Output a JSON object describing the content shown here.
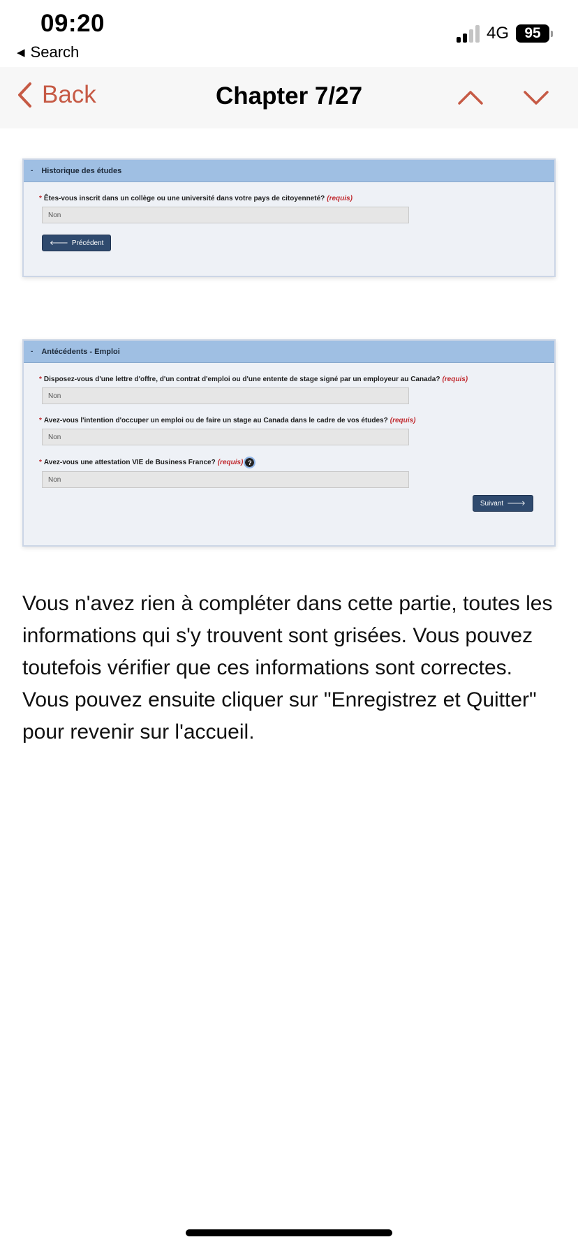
{
  "status_bar": {
    "time": "09:20",
    "back_app": "Search",
    "network": "4G",
    "battery": "95"
  },
  "nav": {
    "back_label": "Back",
    "title": "Chapter 7/27",
    "accent_color": "#c65a45"
  },
  "card1": {
    "header": "Historique des études",
    "collapse_symbol": "-",
    "question": "Êtes-vous inscrit dans un collège ou une université dans votre pays de citoyenneté?",
    "required_label": "(requis)",
    "answer": "Non",
    "prev_button": "Précédent"
  },
  "card2": {
    "header": "Antécédents - Emploi",
    "collapse_symbol": "-",
    "questions": [
      {
        "text": "Disposez-vous d'une lettre d'offre, d'un contrat d'emploi ou d'une entente de stage signé par un employeur au Canada?",
        "required_label": "(requis)",
        "answer": "Non"
      },
      {
        "text": "Avez-vous l'intention d'occuper un emploi ou de faire un stage au Canada dans le cadre de vos études?",
        "required_label": "(requis)",
        "answer": "Non"
      },
      {
        "text": "Avez-vous une attestation VIE de Business France?",
        "required_label": "(requis)",
        "answer": "Non"
      }
    ],
    "next_button": "Suivant"
  },
  "body_text": "Vous n'avez rien à compléter dans cette partie, toutes les informations qui s'y trouvent sont grisées. Vous pouvez toutefois vérifier que ces informations sont correctes. Vous pouvez ensuite cliquer sur \"Enregistrez et Quitter\" pour revenir sur l'accueil."
}
